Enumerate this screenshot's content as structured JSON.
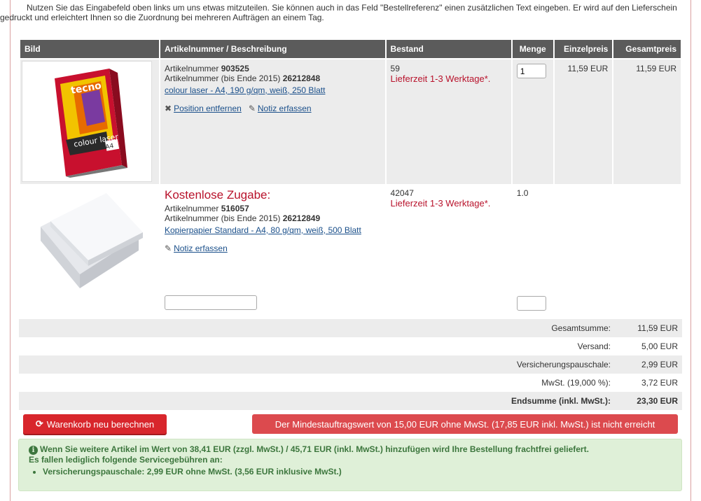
{
  "intro": {
    "line1": "Nutzen Sie das Eingabefeld oben links um uns etwas mitzuteilen. Sie können auch in das Feld \"Bestellreferenz\" einen zusätzlichen Text eingeben. Er wird auf den Lieferschein",
    "line2": "gedruckt und erleichtert Ihnen so die Zuordnung bei mehreren Aufträgen an einem Tag."
  },
  "table": {
    "headers": {
      "image": "Bild",
      "article": "Artikelnummer / Beschreibung",
      "stock": "Bestand",
      "quantity": "Menge",
      "unit_price": "Einzelpreis",
      "total_price": "Gesamtpreis"
    },
    "items": [
      {
        "article_label": "Artikelnummer",
        "article_no": "903525",
        "old_label": "Artikelnummer (bis Ende 2015)",
        "old_no": "26212848",
        "description": "colour laser - A4, 190 g/qm, weiß, 250 Blatt",
        "stock": "59",
        "delivery": "Lieferzeit 1-3 Werktage*.",
        "quantity": "1",
        "unit_price": "11,59 EUR",
        "total_price": "11,59 EUR",
        "remove_label": "Position entfernen",
        "note_label": "Notiz erfassen",
        "box_brand": "tecno",
        "box_line": "colour laser",
        "box_size": "A4"
      },
      {
        "promo": "Kostenlose Zugabe:",
        "article_label": "Artikelnummer",
        "article_no": "516057",
        "old_label": "Artikelnummer (bis Ende 2015)",
        "old_no": "26212849",
        "description": "Kopierpapier Standard - A4, 80 g/qm, weiß, 500 Blatt",
        "stock": "42047",
        "delivery": "Lieferzeit 1-3 Werktage*.",
        "quantity": "1.0",
        "note_label": "Notiz erfassen"
      }
    ]
  },
  "totals": {
    "subtotal_label": "Gesamtsumme:",
    "subtotal": "11,59 EUR",
    "shipping_label": "Versand:",
    "shipping": "5,00 EUR",
    "insurance_label": "Versicherungspauschale:",
    "insurance": "2,99 EUR",
    "vat_label": "MwSt. (19,000 %):",
    "vat": "3,72 EUR",
    "grand_label": "Endsumme (inkl. MwSt.):",
    "grand": "23,30 EUR"
  },
  "buttons": {
    "recalc": "Warenkorb neu berechnen",
    "minimum": "Der Mindestauftragswert von 15,00 EUR ohne MwSt. (17,85 EUR inkl. MwSt.) ist nicht erreicht"
  },
  "notice": {
    "line1": "Wenn Sie weitere Artikel im Wert von 38,41 EUR (zzgl. MwSt.) / 45,71 EUR (inkl. MwSt.) hinzufügen wird Ihre Bestellung frachtfrei geliefert.",
    "line2": "Es fallen lediglich folgende Servicegebühren an:",
    "fee": "Versicherungspauschale: 2,99 EUR ohne MwSt. (3,56 EUR inklusive MwSt.)"
  },
  "colors": {
    "accent": "#d8262c",
    "header": "#5b5b5b",
    "success_bg": "#dff0d8",
    "success_text": "#3c763d"
  }
}
